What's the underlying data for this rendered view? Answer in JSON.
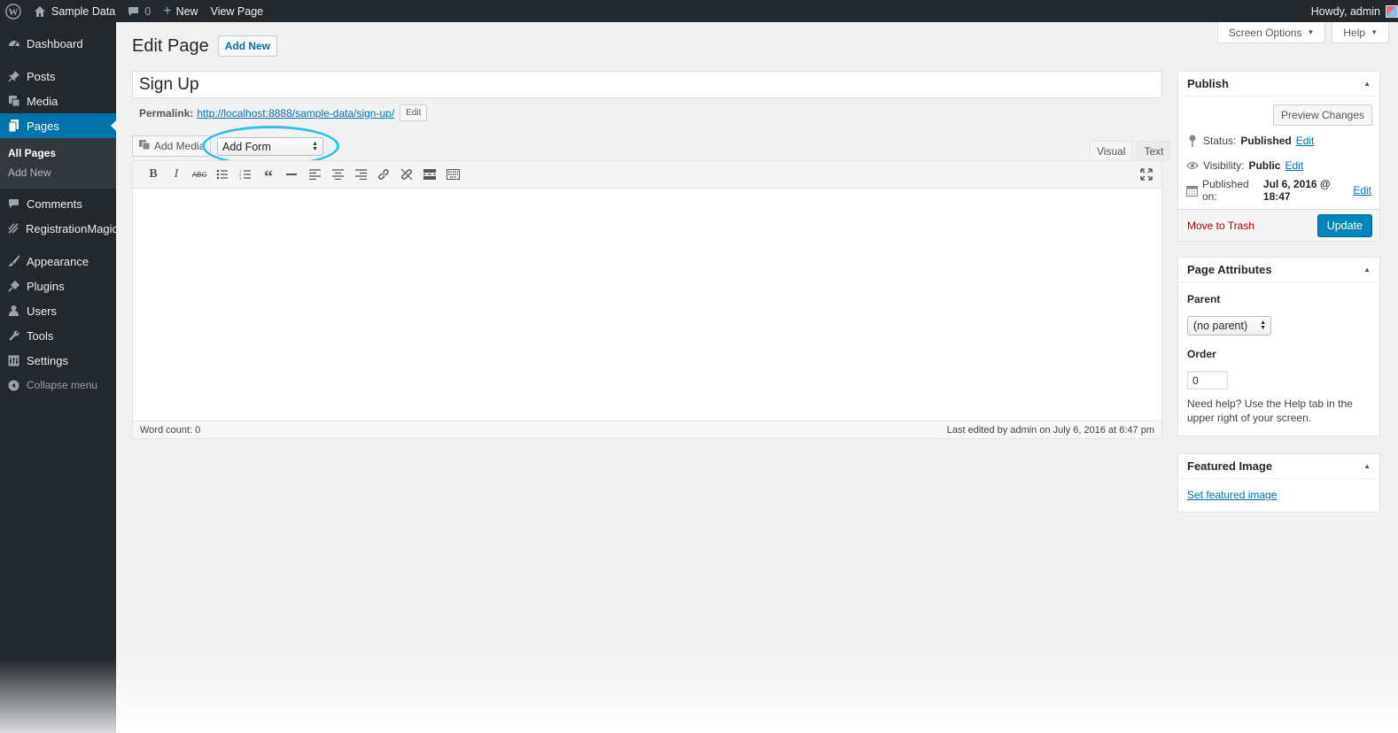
{
  "adminbar": {
    "site_name": "Sample Data",
    "comments_count": "0",
    "new_label": "New",
    "view_page_label": "View Page",
    "howdy": "Howdy, admin"
  },
  "sidebar": {
    "items": [
      {
        "label": "Dashboard",
        "icon": "dashboard-icon"
      },
      {
        "label": "Posts",
        "icon": "pin-icon"
      },
      {
        "label": "Media",
        "icon": "media-icon"
      },
      {
        "label": "Pages",
        "icon": "pages-icon"
      },
      {
        "label": "Comments",
        "icon": "comment-icon"
      },
      {
        "label": "RegistrationMagic",
        "icon": "registration-icon"
      },
      {
        "label": "Appearance",
        "icon": "brush-icon"
      },
      {
        "label": "Plugins",
        "icon": "plug-icon"
      },
      {
        "label": "Users",
        "icon": "user-icon"
      },
      {
        "label": "Tools",
        "icon": "wrench-icon"
      },
      {
        "label": "Settings",
        "icon": "settings-icon"
      }
    ],
    "submenu": [
      "All Pages",
      "Add New"
    ],
    "collapse_label": "Collapse menu"
  },
  "screen_meta": {
    "screen_options": "Screen Options",
    "help": "Help"
  },
  "header": {
    "title": "Edit Page",
    "add_new": "Add New"
  },
  "post_title": "Sign Up",
  "permalink": {
    "label": "Permalink:",
    "url": "http://localhost:8888/sample-data/sign-up/",
    "edit": "Edit"
  },
  "editor": {
    "add_media": "Add Media",
    "add_form": "Add Form",
    "tabs": [
      "Visual",
      "Text"
    ],
    "toolbar": [
      "B",
      "I",
      "ABC",
      "bullet-list",
      "numbered-list",
      "quote",
      "hr",
      "align-left",
      "align-center",
      "align-right",
      "link",
      "unlink",
      "read-more",
      "toolbar-toggle"
    ],
    "word_count": "Word count: 0",
    "last_edited": "Last edited by admin on July 6, 2016 at 6:47 pm"
  },
  "publish": {
    "title": "Publish",
    "preview": "Preview Changes",
    "status_label": "Status:",
    "status_value": "Published",
    "visibility_label": "Visibility:",
    "visibility_value": "Public",
    "published_label": "Published on:",
    "published_value": "Jul 6, 2016 @ 18:47",
    "edit": "Edit",
    "trash": "Move to Trash",
    "update": "Update"
  },
  "page_attributes": {
    "title": "Page Attributes",
    "parent_label": "Parent",
    "parent_value": "(no parent)",
    "order_label": "Order",
    "order_value": "0",
    "help": "Need help? Use the Help tab in the upper right of your screen."
  },
  "featured": {
    "title": "Featured Image",
    "link": "Set featured image"
  },
  "colors": {
    "accent": "#0073aa",
    "highlight": "#29c5e6",
    "adminbar": "#23282d"
  }
}
